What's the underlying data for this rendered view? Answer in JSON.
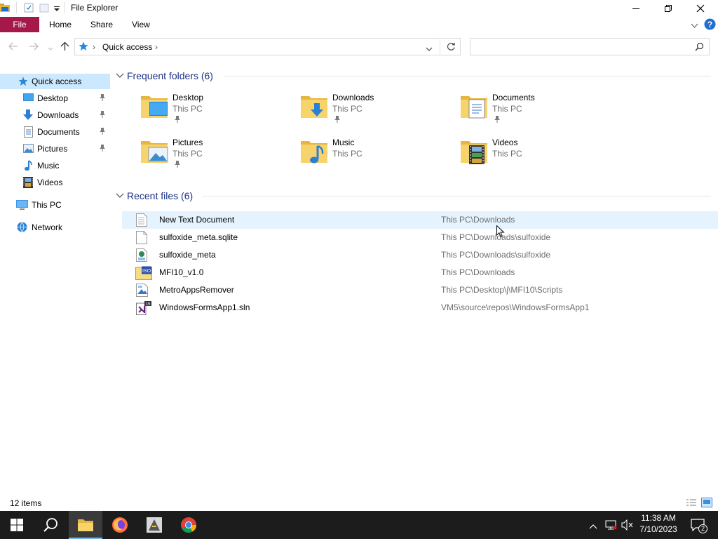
{
  "window": {
    "title": "File Explorer"
  },
  "ribbon": {
    "tabs": [
      "File",
      "Home",
      "Share",
      "View"
    ]
  },
  "address": {
    "location": "Quick access"
  },
  "search": {
    "placeholder": ""
  },
  "nav": {
    "items": [
      {
        "label": "Quick access",
        "icon": "star-icon",
        "pinned": false
      },
      {
        "label": "Desktop",
        "icon": "desktop-icon",
        "pinned": true
      },
      {
        "label": "Downloads",
        "icon": "download-arrow-icon",
        "pinned": true
      },
      {
        "label": "Documents",
        "icon": "documents-icon",
        "pinned": true
      },
      {
        "label": "Pictures",
        "icon": "pictures-icon",
        "pinned": true
      },
      {
        "label": "Music",
        "icon": "music-note-icon",
        "pinned": false
      },
      {
        "label": "Videos",
        "icon": "film-icon",
        "pinned": false
      },
      {
        "label": "This PC",
        "icon": "monitor-icon",
        "pinned": false
      },
      {
        "label": "Network",
        "icon": "network-icon",
        "pinned": false
      }
    ]
  },
  "frequent": {
    "header": "Frequent folders (6)",
    "folders": [
      {
        "name": "Desktop",
        "location": "This PC",
        "pinned": true,
        "overlay": "desktop"
      },
      {
        "name": "Downloads",
        "location": "This PC",
        "pinned": true,
        "overlay": "download"
      },
      {
        "name": "Documents",
        "location": "This PC",
        "pinned": true,
        "overlay": "document"
      },
      {
        "name": "Pictures",
        "location": "This PC",
        "pinned": true,
        "overlay": "picture"
      },
      {
        "name": "Music",
        "location": "This PC",
        "pinned": false,
        "overlay": "music"
      },
      {
        "name": "Videos",
        "location": "This PC",
        "pinned": false,
        "overlay": "video"
      }
    ]
  },
  "recent": {
    "header": "Recent files (6)",
    "files": [
      {
        "name": "New Text Document",
        "path": "This PC\\Downloads",
        "icon": "text-file-icon"
      },
      {
        "name": "sulfoxide_meta.sqlite",
        "path": "This PC\\Downloads\\sulfoxide",
        "icon": "blank-file-icon"
      },
      {
        "name": "sulfoxide_meta",
        "path": "This PC\\Downloads\\sulfoxide",
        "icon": "html-file-icon"
      },
      {
        "name": "MFI10_v1.0",
        "path": "This PC\\Downloads",
        "icon": "iso-file-icon"
      },
      {
        "name": "MetroAppsRemover",
        "path": "This PC\\Desktop\\j\\MFI10\\Scripts",
        "icon": "script-file-icon"
      },
      {
        "name": "WindowsFormsApp1.sln",
        "path": "VM5\\source\\repos\\WindowsFormsApp1",
        "icon": "visual-studio-solution-icon"
      }
    ]
  },
  "status": {
    "item_count": "12 items"
  },
  "taskbar": {
    "time": "11:38 AM",
    "date": "7/10/2023",
    "notification_count": "2"
  },
  "colors": {
    "file_tab": "#a5194a",
    "accent": "#0078d7",
    "group_header": "#1e3287",
    "selection": "#cce8ff"
  }
}
